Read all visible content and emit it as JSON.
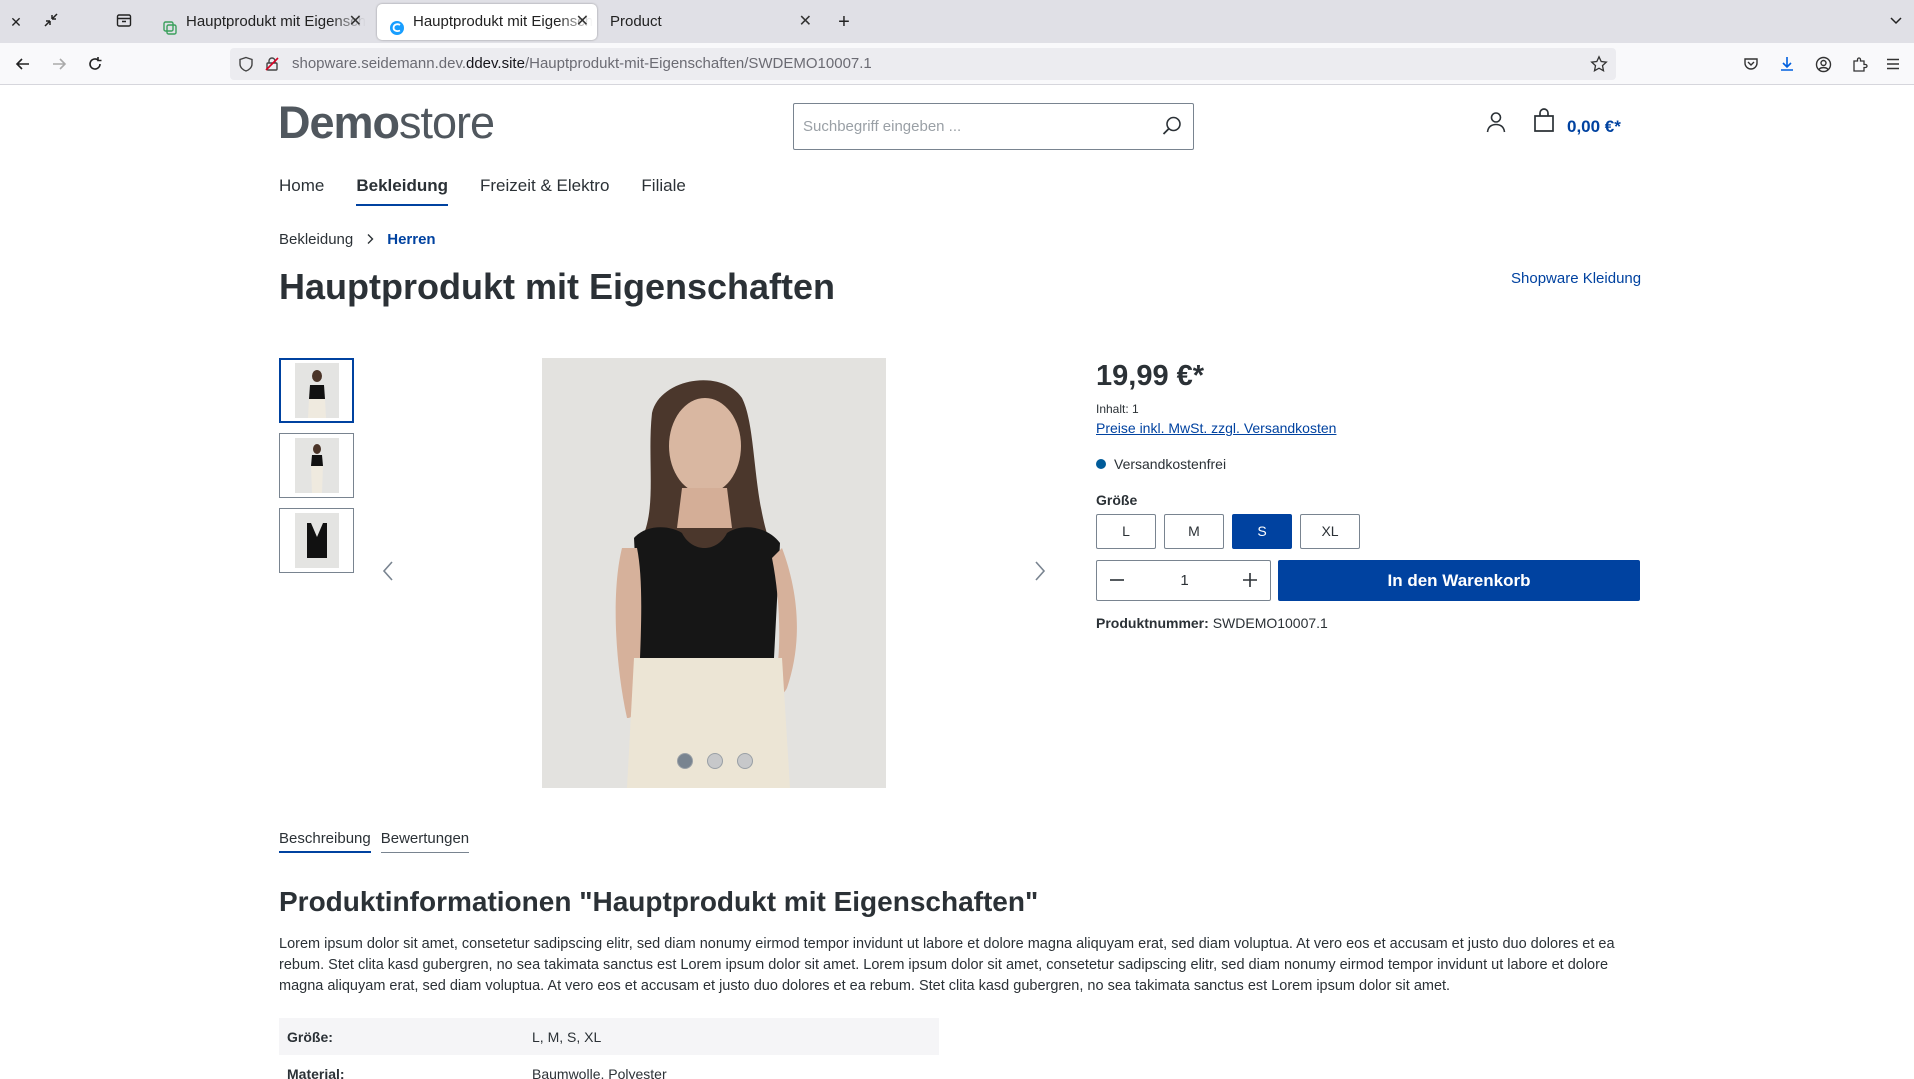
{
  "browser": {
    "tabs": [
      {
        "label": "Hauptprodukt mit Eigenschaften",
        "active": false
      },
      {
        "label": "Hauptprodukt mit Eigenschaften",
        "active": true
      },
      {
        "label": "Product",
        "active": false
      }
    ],
    "url_prefix": "shopware.seidemann.dev.",
    "url_domain": "ddev.site",
    "url_path": "/Hauptprodukt-mit-Eigenschaften/SWDEMO10007.1"
  },
  "header": {
    "logo_bold": "Demo",
    "logo_light": "store",
    "search_placeholder": "Suchbegriff eingeben ...",
    "cart_total": "0,00 €*"
  },
  "nav": {
    "items": [
      {
        "label": "Home",
        "active": false
      },
      {
        "label": "Bekleidung",
        "active": true
      },
      {
        "label": "Freizeit & Elektro",
        "active": false
      },
      {
        "label": "Filiale",
        "active": false
      }
    ]
  },
  "breadcrumb": {
    "parent": "Bekleidung",
    "current": "Herren"
  },
  "product": {
    "title": "Hauptprodukt mit Eigenschaften",
    "manufacturer": "Shopware Kleidung",
    "price": "19,99 €*",
    "content": "Inhalt: 1",
    "tax_note": "Preise inkl. MwSt. zzgl. Versandkosten",
    "shipping": "Versandkostenfrei",
    "size_label": "Größe",
    "sizes": [
      {
        "label": "L",
        "selected": false
      },
      {
        "label": "M",
        "selected": false
      },
      {
        "label": "S",
        "selected": true
      },
      {
        "label": "XL",
        "selected": false
      }
    ],
    "quantity": "1",
    "add_to_cart": "In den Warenkorb",
    "number_label": "Produktnummer:",
    "number": "SWDEMO10007.1"
  },
  "tabs": {
    "description": "Beschreibung",
    "reviews": "Bewertungen"
  },
  "description": {
    "title": "Produktinformationen \"Hauptprodukt mit Eigenschaften\"",
    "text": "Lorem ipsum dolor sit amet, consetetur sadipscing elitr, sed diam nonumy eirmod tempor invidunt ut labore et dolore magna aliquyam erat, sed diam voluptua. At vero eos et accusam et justo duo dolores et ea rebum. Stet clita kasd gubergren, no sea takimata sanctus est Lorem ipsum dolor sit amet. Lorem ipsum dolor sit amet, consetetur sadipscing elitr, sed diam nonumy eirmod tempor invidunt ut labore et dolore magna aliquyam erat, sed diam voluptua. At vero eos et accusam et justo duo dolores et ea rebum. Stet clita kasd gubergren, no sea takimata sanctus est Lorem ipsum dolor sit amet."
  },
  "properties": [
    {
      "name": "Größe:",
      "value": "L, M, S, XL"
    },
    {
      "name": "Material:",
      "value": "Baumwolle, Polyester"
    }
  ],
  "colors": {
    "accent": "#0042a0",
    "text": "#2b3136",
    "border": "#798490"
  }
}
